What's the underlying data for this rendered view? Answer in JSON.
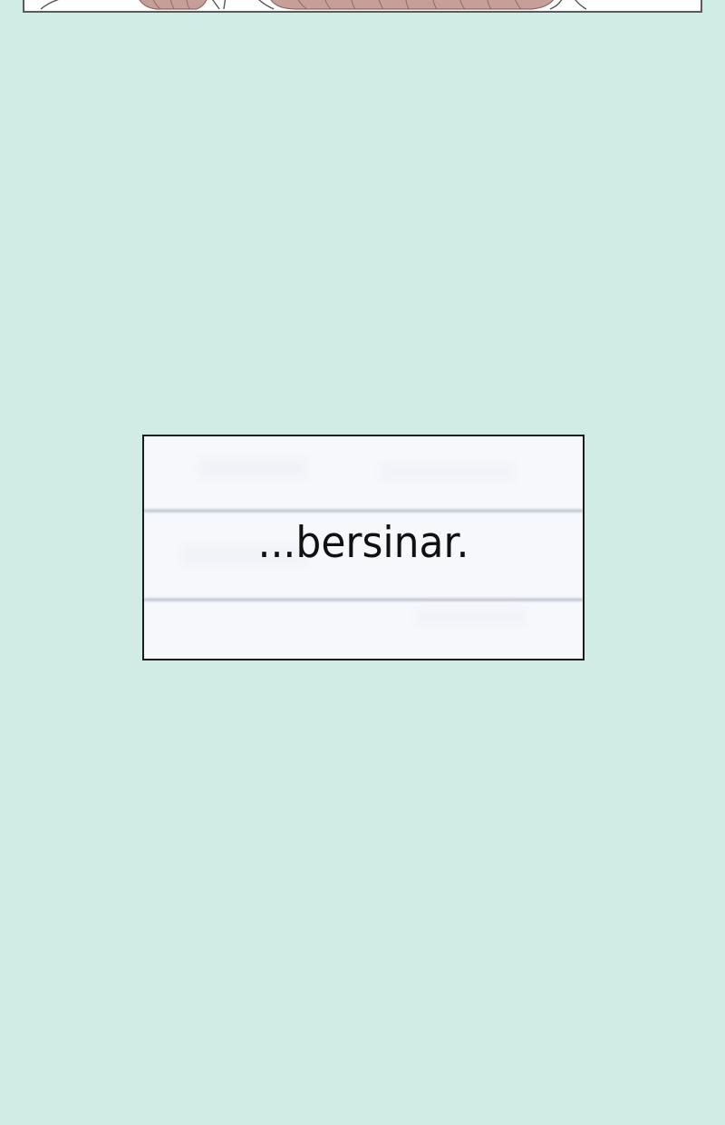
{
  "background_color": "#d1ebe5",
  "caption": {
    "text": "...bersinar.",
    "box_color": "#f6f8fc",
    "border_color": "#1c1c1c",
    "ruled_line_color": "#b9bfcc"
  },
  "top_panel": {
    "border_color": "#5a5a5a",
    "hair_color": "#b78f8a"
  }
}
